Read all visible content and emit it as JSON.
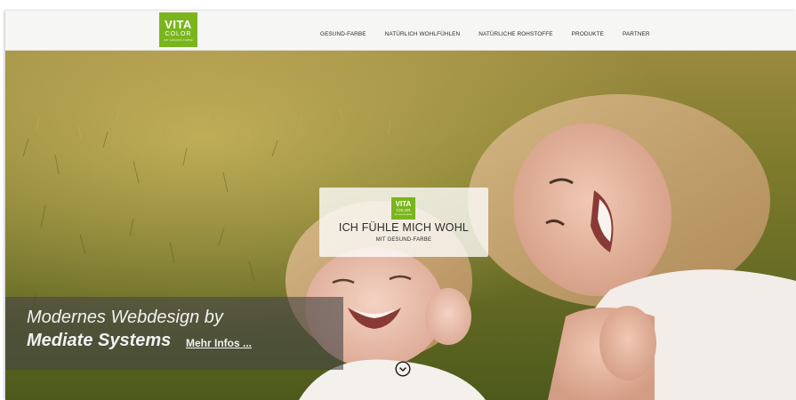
{
  "header": {
    "logo": {
      "line1": "VITA",
      "line2": "COLOR",
      "line3": "MIT GESUND-FARBE"
    },
    "nav": [
      "GESUND-FARBE",
      "NATÜRLICH WOHLFÜHLEN",
      "NATÜRLICHE ROHSTOFFE",
      "PRODUKTE",
      "PARTNER"
    ]
  },
  "hero": {
    "card": {
      "logo": {
        "line1": "VITA",
        "line2": "COLOR",
        "line3": "MIT GESUND-FARBE"
      },
      "title": "ICH FÜHLE MICH WOHL",
      "subtitle": "MIT GESUND-FARBE"
    },
    "promo": {
      "line1": "Modernes Webdesign by",
      "line2": "Mediate Systems",
      "link": "Mehr Infos ..."
    },
    "scroll_icon": "chevron-down-circle-icon"
  },
  "colors": {
    "brand_green": "#7ab51d",
    "nav_bg": "#f6f6f4",
    "promo_bg": "#464646"
  }
}
